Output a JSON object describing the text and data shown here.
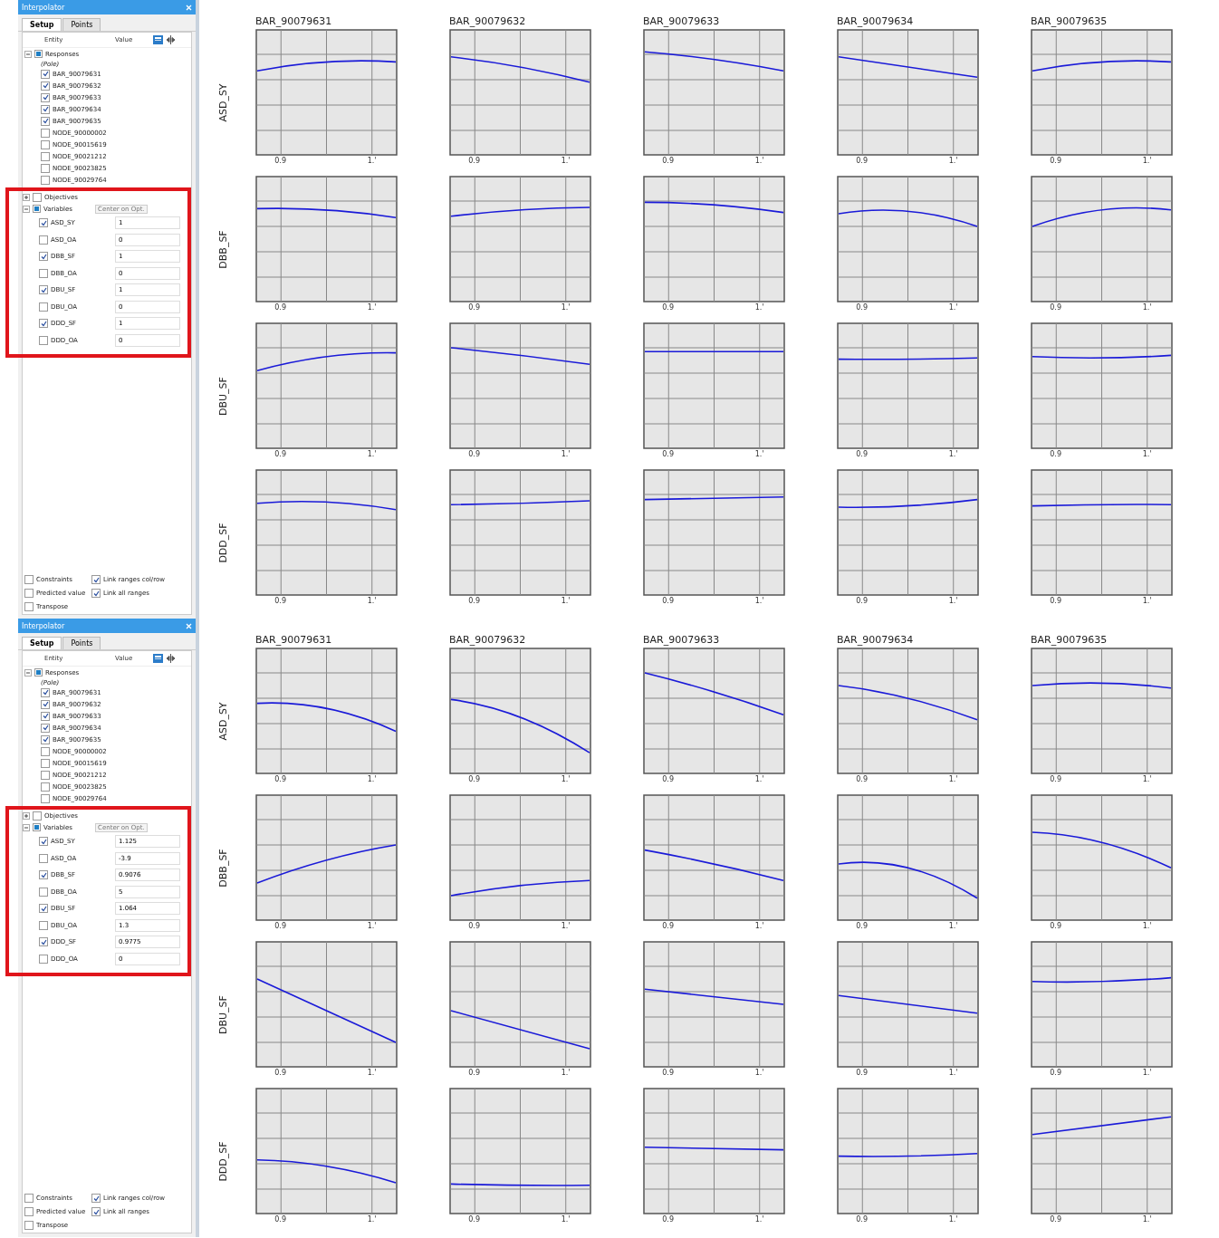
{
  "screens": [
    {
      "window": {
        "title": "Interpolator"
      },
      "tabs": [
        {
          "label": "Setup",
          "selected": true
        },
        {
          "label": "Points",
          "selected": false
        }
      ],
      "columns": [
        "Entity",
        "Value"
      ],
      "responses": {
        "label": "Responses",
        "expanded": true,
        "subtitle": "(Pole)",
        "items": [
          {
            "label": "BAR_90079631",
            "checked": true
          },
          {
            "label": "BAR_90079632",
            "checked": true
          },
          {
            "label": "BAR_90079633",
            "checked": true
          },
          {
            "label": "BAR_90079634",
            "checked": true
          },
          {
            "label": "BAR_90079635",
            "checked": true
          },
          {
            "label": "NODE_90000002",
            "checked": false
          },
          {
            "label": "NODE_90015619",
            "checked": false
          },
          {
            "label": "NODE_90021212",
            "checked": false
          },
          {
            "label": "NODE_90023825",
            "checked": false
          },
          {
            "label": "NODE_90029764",
            "checked": false
          }
        ]
      },
      "objectives": {
        "label": "Objectives",
        "expanded": false,
        "checked": false
      },
      "variables": {
        "label": "Variables",
        "expanded": true,
        "button": "Center on Opt.",
        "items": [
          {
            "label": "ASD_SY",
            "checked": true,
            "value": "1"
          },
          {
            "label": "ASD_OA",
            "checked": false,
            "value": "0"
          },
          {
            "label": "DBB_SF",
            "checked": true,
            "value": "1"
          },
          {
            "label": "DBB_OA",
            "checked": false,
            "value": "0"
          },
          {
            "label": "DBU_SF",
            "checked": true,
            "value": "1"
          },
          {
            "label": "DBU_OA",
            "checked": false,
            "value": "0"
          },
          {
            "label": "DDD_SF",
            "checked": true,
            "value": "1"
          },
          {
            "label": "DDD_OA",
            "checked": false,
            "value": "0"
          }
        ]
      },
      "options": [
        {
          "label": "Constraints",
          "checked": false
        },
        {
          "label": "Link ranges col/row",
          "checked": true
        },
        {
          "label": "Predicted value",
          "checked": false
        },
        {
          "label": "Link all ranges",
          "checked": true
        },
        {
          "label": "Transpose",
          "checked": false
        }
      ],
      "grid": {
        "columns": [
          "BAR_90079631",
          "BAR_90079632",
          "BAR_90079633",
          "BAR_90079634",
          "BAR_90079635"
        ],
        "rows": [
          "ASD_SY",
          "DBB_SF",
          "DBU_SF",
          "DDD_SF"
        ],
        "plots": [
          {
            "x_tick_labels": [
              "0.9",
              "1.'"
            ]
          },
          {
            "x_tick_labels": [
              "0.9",
              "1.'"
            ]
          },
          {
            "x_tick_labels": [
              "0.9",
              "1.'"
            ]
          },
          {
            "x_tick_labels": [
              "0.9",
              "1.'"
            ]
          },
          {
            "x_tick_labels": [
              "0.9",
              "1.'"
            ]
          },
          {
            "x_tick_labels": [
              "0.9",
              "1.'"
            ]
          },
          {
            "x_tick_labels": [
              "0.9",
              "1.'"
            ]
          },
          {
            "x_tick_labels": [
              "0.9",
              "1.'"
            ]
          },
          {
            "x_tick_labels": [
              "0.9",
              "1.'"
            ]
          },
          {
            "x_tick_labels": [
              "0.9",
              "1.'"
            ]
          },
          {
            "x_tick_labels": [
              "0.9",
              "1.'"
            ]
          },
          {
            "x_tick_labels": [
              "0.9",
              "1.'"
            ]
          },
          {
            "x_tick_labels": [
              "0.9",
              "1.'"
            ]
          },
          {
            "x_tick_labels": [
              "0.9",
              "1.'"
            ]
          },
          {
            "x_tick_labels": [
              "0.9",
              "1.'"
            ]
          },
          {
            "x_tick_labels": [
              "0.9",
              "1.'"
            ]
          },
          {
            "x_tick_labels": [
              "0.9",
              "1.'"
            ]
          },
          {
            "x_tick_labels": [
              "0.9",
              "1.'"
            ]
          },
          {
            "x_tick_labels": [
              "0.9",
              "1.'"
            ]
          },
          {
            "x_tick_labels": [
              "0.9",
              "1.'"
            ]
          }
        ]
      }
    },
    {
      "window": {
        "title": "Interpolator"
      },
      "tabs": [
        {
          "label": "Setup",
          "selected": true
        },
        {
          "label": "Points",
          "selected": false
        }
      ],
      "columns": [
        "Entity",
        "Value"
      ],
      "responses": {
        "label": "Responses",
        "expanded": true,
        "subtitle": "(Pole)",
        "items": [
          {
            "label": "BAR_90079631",
            "checked": true
          },
          {
            "label": "BAR_90079632",
            "checked": true
          },
          {
            "label": "BAR_90079633",
            "checked": true
          },
          {
            "label": "BAR_90079634",
            "checked": true
          },
          {
            "label": "BAR_90079635",
            "checked": true
          },
          {
            "label": "NODE_90000002",
            "checked": false
          },
          {
            "label": "NODE_90015619",
            "checked": false
          },
          {
            "label": "NODE_90021212",
            "checked": false
          },
          {
            "label": "NODE_90023825",
            "checked": false
          },
          {
            "label": "NODE_90029764",
            "checked": false
          }
        ]
      },
      "objectives": {
        "label": "Objectives",
        "expanded": false,
        "checked": false
      },
      "variables": {
        "label": "Variables",
        "expanded": true,
        "button": "Center on Opt.",
        "items": [
          {
            "label": "ASD_SY",
            "checked": true,
            "value": "1.125"
          },
          {
            "label": "ASD_OA",
            "checked": false,
            "value": "-3.9"
          },
          {
            "label": "DBB_SF",
            "checked": true,
            "value": "0.9076"
          },
          {
            "label": "DBB_OA",
            "checked": false,
            "value": "5"
          },
          {
            "label": "DBU_SF",
            "checked": true,
            "value": "1.064"
          },
          {
            "label": "DBU_OA",
            "checked": false,
            "value": "1.3"
          },
          {
            "label": "DDD_SF",
            "checked": true,
            "value": "0.9775"
          },
          {
            "label": "DDD_OA",
            "checked": false,
            "value": "0"
          }
        ]
      },
      "options": [
        {
          "label": "Constraints",
          "checked": false
        },
        {
          "label": "Link ranges col/row",
          "checked": true
        },
        {
          "label": "Predicted value",
          "checked": false
        },
        {
          "label": "Link all ranges",
          "checked": true
        },
        {
          "label": "Transpose",
          "checked": false
        }
      ],
      "grid": {
        "columns": [
          "BAR_90079631",
          "BAR_90079632",
          "BAR_90079633",
          "BAR_90079634",
          "BAR_90079635"
        ],
        "rows": [
          "ASD_SY",
          "DBB_SF",
          "DBU_SF",
          "DDD_SF"
        ],
        "plots": [
          {
            "x_tick_labels": [
              "0.9",
              "1.'"
            ]
          },
          {
            "x_tick_labels": [
              "0.9",
              "1.'"
            ]
          },
          {
            "x_tick_labels": [
              "0.9",
              "1.'"
            ]
          },
          {
            "x_tick_labels": [
              "0.9",
              "1.'"
            ]
          },
          {
            "x_tick_labels": [
              "0.9",
              "1.'"
            ]
          },
          {
            "x_tick_labels": [
              "0.9",
              "1.'"
            ]
          },
          {
            "x_tick_labels": [
              "0.9",
              "1.'"
            ]
          },
          {
            "x_tick_labels": [
              "0.9",
              "1.'"
            ]
          },
          {
            "x_tick_labels": [
              "0.9",
              "1.'"
            ]
          },
          {
            "x_tick_labels": [
              "0.9",
              "1.'"
            ]
          },
          {
            "x_tick_labels": [
              "0.9",
              "1.'"
            ]
          },
          {
            "x_tick_labels": [
              "0.9",
              "1.'"
            ]
          },
          {
            "x_tick_labels": [
              "0.9",
              "1.'"
            ]
          },
          {
            "x_tick_labels": [
              "0.9",
              "1.'"
            ]
          },
          {
            "x_tick_labels": [
              "0.9",
              "1.'"
            ]
          },
          {
            "x_tick_labels": [
              "0.9",
              "1.'"
            ]
          },
          {
            "x_tick_labels": [
              "0.9",
              "1.'"
            ]
          },
          {
            "x_tick_labels": [
              "0.9",
              "1.'"
            ]
          },
          {
            "x_tick_labels": [
              "0.9",
              "1.'"
            ]
          },
          {
            "x_tick_labels": [
              "0.9",
              "1.'"
            ]
          }
        ]
      }
    }
  ]
}
